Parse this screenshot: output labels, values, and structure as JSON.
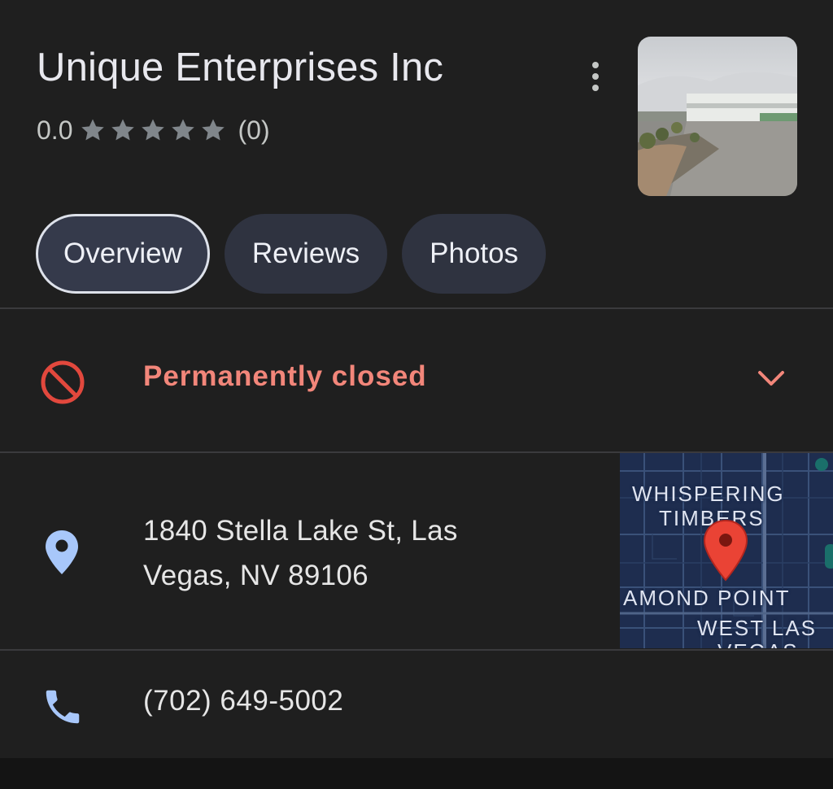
{
  "place": {
    "name": "Unique Enterprises Inc",
    "rating": "0.0",
    "stars": 5,
    "review_count": "(0)"
  },
  "tabs": [
    {
      "label": "Overview",
      "active": true
    },
    {
      "label": "Reviews",
      "active": false
    },
    {
      "label": "Photos",
      "active": false
    }
  ],
  "status": {
    "label": "Permanently closed",
    "icon": "no-entry-icon",
    "color": "#f2867a"
  },
  "address": {
    "line1": "1840 Stella Lake St, Las",
    "line2": "Vegas, NV 89106",
    "icon": "location-pin-icon"
  },
  "map": {
    "labels": [
      "WHISPERING",
      "TIMBERS",
      "AMOND POINT",
      "WEST LAS",
      "VEGAS"
    ]
  },
  "phone": {
    "number": "(702) 649-5002",
    "icon": "phone-icon"
  },
  "colors": {
    "background": "#1f1f1f",
    "accent_blue": "#a8c7fa",
    "closed_red": "#f2867a",
    "tab_bg": "#2f3340"
  }
}
